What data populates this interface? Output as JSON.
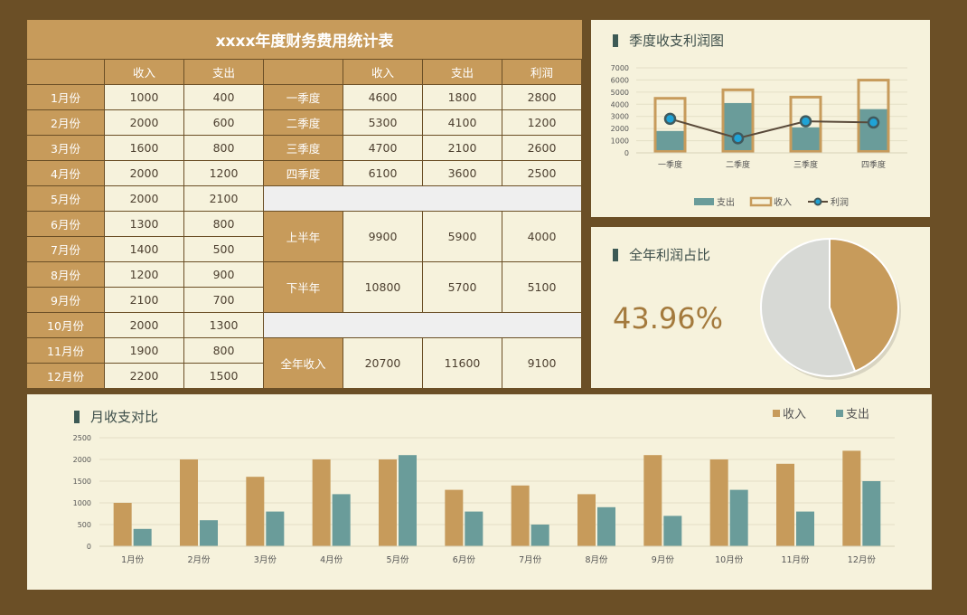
{
  "colors": {
    "background": "#6b4f26",
    "panel": "#f6f2dc",
    "gold": "#c79b5b",
    "teal": "#6a9c9a",
    "line": "#5a4a3a",
    "dot": "#1fa3d6"
  },
  "table": {
    "title": "xxxx年度财务费用统计表",
    "monthly_headers": [
      "",
      "收入",
      "支出"
    ],
    "months": [
      {
        "label": "1月份",
        "income": "1000",
        "expense": "400"
      },
      {
        "label": "2月份",
        "income": "2000",
        "expense": "600"
      },
      {
        "label": "3月份",
        "income": "1600",
        "expense": "800"
      },
      {
        "label": "4月份",
        "income": "2000",
        "expense": "1200"
      },
      {
        "label": "5月份",
        "income": "2000",
        "expense": "2100"
      },
      {
        "label": "6月份",
        "income": "1300",
        "expense": "800"
      },
      {
        "label": "7月份",
        "income": "1400",
        "expense": "500"
      },
      {
        "label": "8月份",
        "income": "1200",
        "expense": "900"
      },
      {
        "label": "9月份",
        "income": "2100",
        "expense": "700"
      },
      {
        "label": "10月份",
        "income": "2000",
        "expense": "1300"
      },
      {
        "label": "11月份",
        "income": "1900",
        "expense": "800"
      },
      {
        "label": "12月份",
        "income": "2200",
        "expense": "1500"
      }
    ],
    "summary_headers": [
      "",
      "收入",
      "支出",
      "利润"
    ],
    "quarters": [
      {
        "label": "一季度",
        "income": "4600",
        "expense": "1800",
        "profit": "2800"
      },
      {
        "label": "二季度",
        "income": "5300",
        "expense": "4100",
        "profit": "1200"
      },
      {
        "label": "三季度",
        "income": "4700",
        "expense": "2100",
        "profit": "2600"
      },
      {
        "label": "四季度",
        "income": "6100",
        "expense": "3600",
        "profit": "2500"
      }
    ],
    "halves": [
      {
        "label": "上半年",
        "income": "9900",
        "expense": "5900",
        "profit": "4000"
      },
      {
        "label": "下半年",
        "income": "10800",
        "expense": "5700",
        "profit": "5100"
      }
    ],
    "annual": {
      "label": "全年收入",
      "income": "20700",
      "expense": "11600",
      "profit": "9100"
    }
  },
  "quarter_chart": {
    "title": "季度收支利润图",
    "legend": [
      "支出",
      "收入",
      "利润"
    ]
  },
  "pie_chart": {
    "title": "全年利润占比",
    "percent_label": "43.96%"
  },
  "month_chart": {
    "title": "月收支对比",
    "legend": [
      "收入",
      "支出"
    ]
  },
  "chart_data": [
    {
      "type": "bar",
      "title": "季度收支利润图",
      "categories": [
        "一季度",
        "二季度",
        "三季度",
        "四季度"
      ],
      "series": [
        {
          "name": "支出",
          "values": [
            1800,
            4100,
            2100,
            3600
          ]
        },
        {
          "name": "收入",
          "values": [
            4600,
            5300,
            4700,
            6100
          ]
        },
        {
          "name": "利润",
          "type": "line",
          "values": [
            2800,
            1200,
            2600,
            2500
          ]
        }
      ],
      "ylim": [
        0,
        7000
      ],
      "yticks": [
        "0",
        "1000",
        "2000",
        "3000",
        "4000",
        "5000",
        "6000",
        "7000"
      ],
      "legend_position": "bottom"
    },
    {
      "type": "pie",
      "title": "全年利润占比",
      "slices": [
        {
          "value": 43.96
        },
        {
          "value": 56.04
        }
      ]
    },
    {
      "type": "bar",
      "title": "月收支对比",
      "categories": [
        "1月份",
        "2月份",
        "3月份",
        "4月份",
        "5月份",
        "6月份",
        "7月份",
        "8月份",
        "9月份",
        "10月份",
        "11月份",
        "12月份"
      ],
      "series": [
        {
          "name": "收入",
          "values": [
            1000,
            2000,
            1600,
            2000,
            2000,
            1300,
            1400,
            1200,
            2100,
            2000,
            1900,
            2200
          ]
        },
        {
          "name": "支出",
          "values": [
            400,
            600,
            800,
            1200,
            2100,
            800,
            500,
            900,
            700,
            1300,
            800,
            1500
          ]
        }
      ],
      "ylim": [
        0,
        2500
      ],
      "yticks": [
        "0",
        "500",
        "1000",
        "1500",
        "2000",
        "2500"
      ],
      "legend_position": "top-right"
    }
  ]
}
